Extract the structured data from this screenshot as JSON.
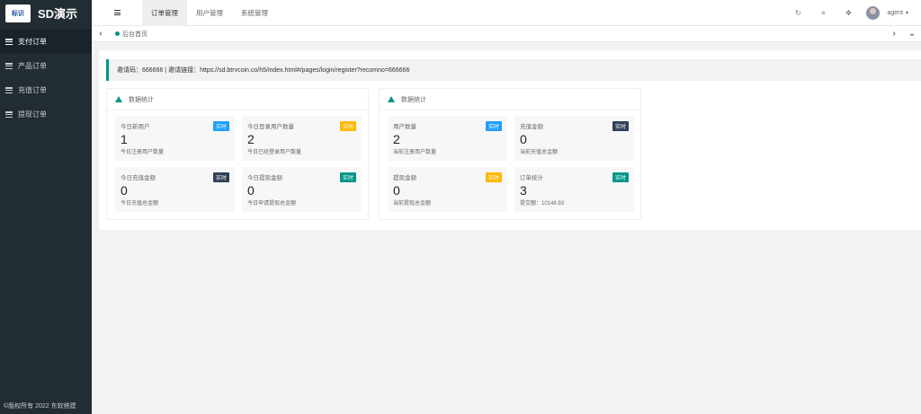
{
  "app": {
    "logo_text": "SD演示",
    "logo_badge": "标识"
  },
  "sidebar": {
    "items": [
      {
        "label": "支付订单"
      },
      {
        "label": "产品订单"
      },
      {
        "label": "充值订单"
      },
      {
        "label": "提现订单"
      }
    ],
    "footer": "©版权所有 2022 东软搭建"
  },
  "topbar": {
    "tabs": [
      {
        "label": "订单管理"
      },
      {
        "label": "用户管理"
      },
      {
        "label": "系统管理"
      }
    ],
    "icons": {
      "refresh": "↻",
      "clear": "≡",
      "fullscreen": "✥"
    },
    "user": {
      "name": "agent",
      "caret": "▾"
    }
  },
  "breadcrumb": {
    "home": "后台首页",
    "left_arrow": "‹",
    "right_arrow": "›",
    "down_arrow": "⌄"
  },
  "notice": {
    "text": "邀请码：666666 | 邀请链接：https://sd.btrvcoin.co/h5/index.html#/pages/login/register?recomno=666666"
  },
  "panels": [
    {
      "title": "数据统计",
      "cards": [
        {
          "label": "今日新用户",
          "badge": "实时",
          "badge_color": "#1e9fff",
          "value": "1",
          "sub": "今日注册用户数量"
        },
        {
          "label": "今日登录用户数量",
          "badge": "实时",
          "badge_color": "#ffb800",
          "value": "2",
          "sub": "今日已经登录用户数量"
        },
        {
          "label": "今日充值金额",
          "badge": "实时",
          "badge_color": "#2f4056",
          "value": "0",
          "sub": "今日充值总金额"
        },
        {
          "label": "今日提现金额",
          "badge": "实时",
          "badge_color": "#009688",
          "value": "0",
          "sub": "今日申请提现总金额"
        }
      ]
    },
    {
      "title": "数据统计",
      "cards": [
        {
          "label": "用户数量",
          "badge": "实时",
          "badge_color": "#1e9fff",
          "value": "2",
          "sub": "当前注册用户数量"
        },
        {
          "label": "充值金额",
          "badge": "实时",
          "badge_color": "#2f4056",
          "value": "0",
          "sub": "当前充值总金额"
        },
        {
          "label": "提现金额",
          "badge": "实时",
          "badge_color": "#ffb800",
          "value": "0",
          "sub": "当前提现总金额"
        },
        {
          "label": "订单统计",
          "badge": "实时",
          "badge_color": "#009688",
          "value": "3",
          "sub": "提交额：10148.93"
        }
      ]
    }
  ]
}
